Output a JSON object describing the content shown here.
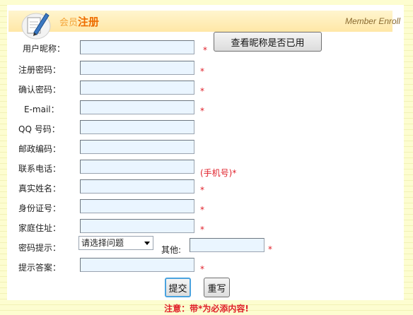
{
  "header": {
    "title_prefix": "会员",
    "title_main": "注册",
    "title_en": "Member Enroll"
  },
  "fields": [
    {
      "label": "用户昵称：",
      "required": true
    },
    {
      "label": "注册密码：",
      "required": true
    },
    {
      "label": "确认密码：",
      "required": true
    },
    {
      "label": "E-mail：",
      "required": true
    },
    {
      "label": "QQ 号码：",
      "required": false
    },
    {
      "label": "邮政编码：",
      "required": false
    },
    {
      "label": "联系电话：",
      "required": false,
      "hint": "(手机号)*"
    },
    {
      "label": "真实姓名：",
      "required": true
    },
    {
      "label": "身份证号：",
      "required": true
    },
    {
      "label": "家庭住址：",
      "required": true
    }
  ],
  "password_hint": {
    "label": "密码提示：",
    "select_value": "请选择问题",
    "other_label": "其他:"
  },
  "answer": {
    "label": "提示答案："
  },
  "check_button": "查看昵称是否已用",
  "star": "*",
  "buttons": {
    "submit": "提交",
    "reset": "重写"
  },
  "notice": "注意：带*为必添内容!"
}
